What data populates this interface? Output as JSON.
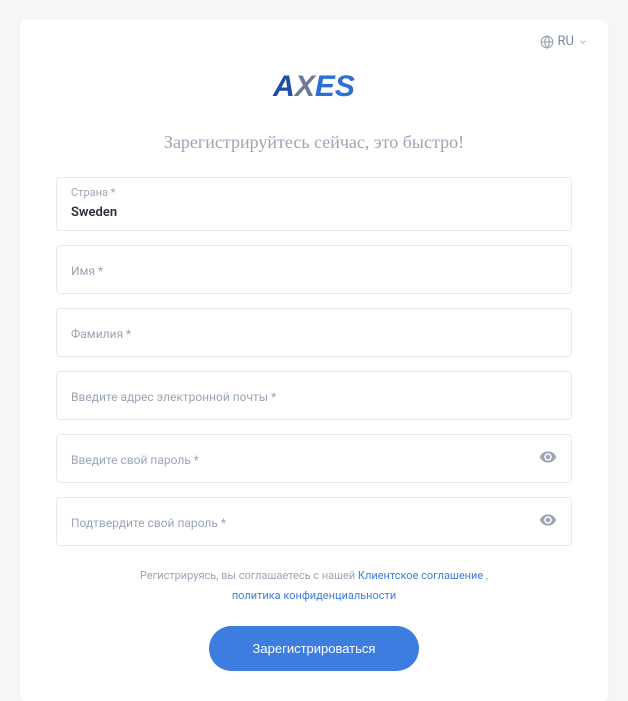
{
  "lang": {
    "label": "RU"
  },
  "logo": {
    "part_a": "A",
    "part_x": "X",
    "part_es": "ES"
  },
  "heading": "Зарегистрируйтесь сейчас, это быстро!",
  "fields": {
    "country": {
      "label": "Страна *",
      "value": "Sweden"
    },
    "firstname": {
      "placeholder": "Имя *"
    },
    "lastname": {
      "placeholder": "Фамилия *"
    },
    "email": {
      "placeholder": "Введите адрес электронной почты *"
    },
    "password": {
      "placeholder": "Введите свой пароль *"
    },
    "password_confirm": {
      "placeholder": "Подтвердите свой пароль *"
    }
  },
  "agreement": {
    "prefix": "Регистрируясь, вы соглашаетесь с нашей ",
    "link1": "Клиентское соглашение",
    "comma": " , ",
    "link2": "политика конфиденциальности"
  },
  "submit": {
    "label": "Зарегистрироваться"
  }
}
